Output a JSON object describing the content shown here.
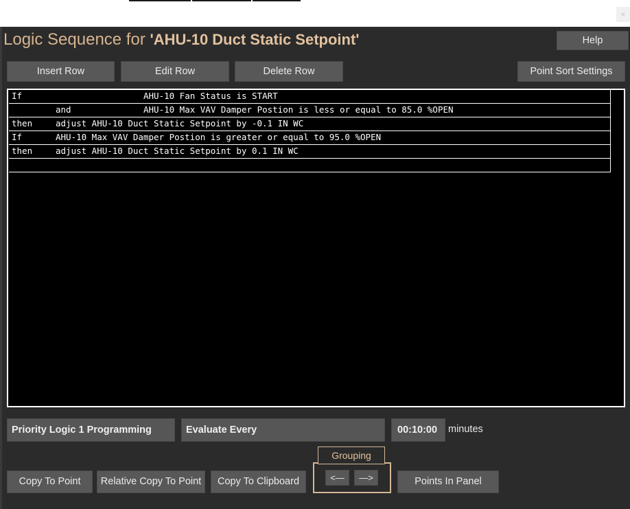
{
  "window": {
    "close_glyph": "×",
    "title_prefix": "Logic Sequence for ",
    "title_name": "'AHU-10 Duct Static Setpoint'"
  },
  "toolbar": {
    "help": "Help",
    "insert_row": "Insert Row",
    "edit_row": "Edit Row",
    "delete_row": "Delete Row",
    "point_sort_settings": "Point Sort Settings"
  },
  "logic_rows": [
    {
      "keyword": "If",
      "content": "AHU-10 Fan Status is START",
      "indent": "deep"
    },
    {
      "keyword": "and",
      "content": "AHU-10 Max VAV Damper Postion is less or equal to 85.0 %OPEN",
      "indent": "deep"
    },
    {
      "keyword": "then",
      "content": "adjust AHU-10 Duct Static Setpoint by -0.1 IN WC",
      "indent": "shallow"
    },
    {
      "keyword": "If",
      "content": "AHU-10 Max VAV Damper Postion is greater or equal to 95.0 %OPEN",
      "indent": "shallow"
    },
    {
      "keyword": "then",
      "content": "adjust AHU-10 Duct Static Setpoint by 0.1 IN WC",
      "indent": "shallow"
    },
    {
      "keyword": "",
      "content": "",
      "indent": "shallow"
    }
  ],
  "settings": {
    "priority_logic": "Priority Logic 1 Programming",
    "evaluate_every": "Evaluate Every",
    "interval": "00:10:00",
    "interval_unit": "minutes"
  },
  "bottom": {
    "copy_to_point": "Copy To Point",
    "relative_copy_to_point": "Relative Copy To Point",
    "copy_to_clipboard": "Copy To Clipboard",
    "grouping_label": "Grouping",
    "group_prev": "<—",
    "group_next": "—>",
    "points_in_panel": "Points In Panel"
  },
  "colors": {
    "background": "#2b2b2b",
    "title_accent": "#e2c29e",
    "button": "#585858",
    "logic_bg": "#000000"
  }
}
